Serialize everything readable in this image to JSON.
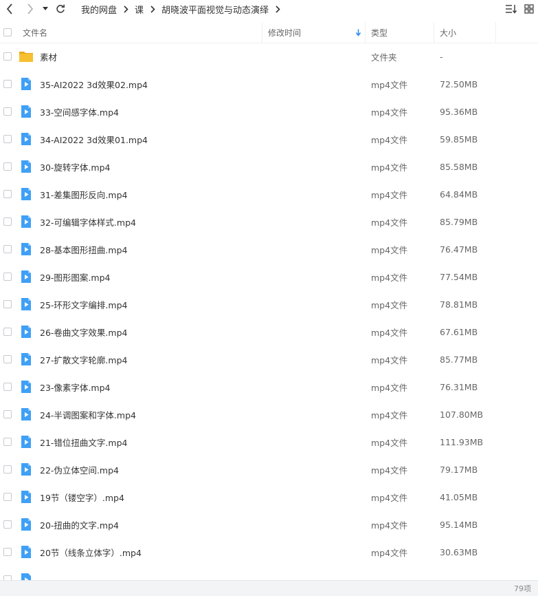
{
  "breadcrumb": [
    "我的网盘",
    "课",
    "胡晓波平面视觉与动态演绎"
  ],
  "columns": {
    "name": "文件名",
    "modified": "修改时间",
    "type": "类型",
    "size": "大小"
  },
  "colors": {
    "accent": "#2b8bf0",
    "folder": "#f7c031",
    "video": "#3fa0f6"
  },
  "files": [
    {
      "name": "素材",
      "type": "文件夹",
      "size": "-",
      "icon": "folder-icon"
    },
    {
      "name": "35-AI2022 3d效果02.mp4",
      "type": "mp4文件",
      "size": "72.50MB",
      "icon": "video-file-icon"
    },
    {
      "name": "33-空间感字体.mp4",
      "type": "mp4文件",
      "size": "95.36MB",
      "icon": "video-file-icon"
    },
    {
      "name": "34-AI2022 3d效果01.mp4",
      "type": "mp4文件",
      "size": "59.85MB",
      "icon": "video-file-icon"
    },
    {
      "name": "30-旋转字体.mp4",
      "type": "mp4文件",
      "size": "85.58MB",
      "icon": "video-file-icon"
    },
    {
      "name": "31-差集图形反向.mp4",
      "type": "mp4文件",
      "size": "64.84MB",
      "icon": "video-file-icon"
    },
    {
      "name": "32-可编辑字体样式.mp4",
      "type": "mp4文件",
      "size": "85.79MB",
      "icon": "video-file-icon"
    },
    {
      "name": "28-基本图形扭曲.mp4",
      "type": "mp4文件",
      "size": "76.47MB",
      "icon": "video-file-icon"
    },
    {
      "name": "29-图形图案.mp4",
      "type": "mp4文件",
      "size": "77.54MB",
      "icon": "video-file-icon"
    },
    {
      "name": "25-环形文字编排.mp4",
      "type": "mp4文件",
      "size": "78.81MB",
      "icon": "video-file-icon"
    },
    {
      "name": "26-卷曲文字效果.mp4",
      "type": "mp4文件",
      "size": "67.61MB",
      "icon": "video-file-icon"
    },
    {
      "name": "27-扩散文字轮廓.mp4",
      "type": "mp4文件",
      "size": "85.77MB",
      "icon": "video-file-icon"
    },
    {
      "name": "23-像素字体.mp4",
      "type": "mp4文件",
      "size": "76.31MB",
      "icon": "video-file-icon"
    },
    {
      "name": "24-半调图案和字体.mp4",
      "type": "mp4文件",
      "size": "107.80MB",
      "icon": "video-file-icon"
    },
    {
      "name": "21-错位扭曲文字.mp4",
      "type": "mp4文件",
      "size": "111.93MB",
      "icon": "video-file-icon"
    },
    {
      "name": "22-伪立体空间.mp4",
      "type": "mp4文件",
      "size": "79.17MB",
      "icon": "video-file-icon"
    },
    {
      "name": "19节（镂空字）.mp4",
      "type": "mp4文件",
      "size": "41.05MB",
      "icon": "video-file-icon"
    },
    {
      "name": "20-扭曲的文字.mp4",
      "type": "mp4文件",
      "size": "95.14MB",
      "icon": "video-file-icon"
    },
    {
      "name": "20节（线条立体字）.mp4",
      "type": "mp4文件",
      "size": "30.63MB",
      "icon": "video-file-icon"
    }
  ],
  "status": {
    "count": "79项"
  }
}
